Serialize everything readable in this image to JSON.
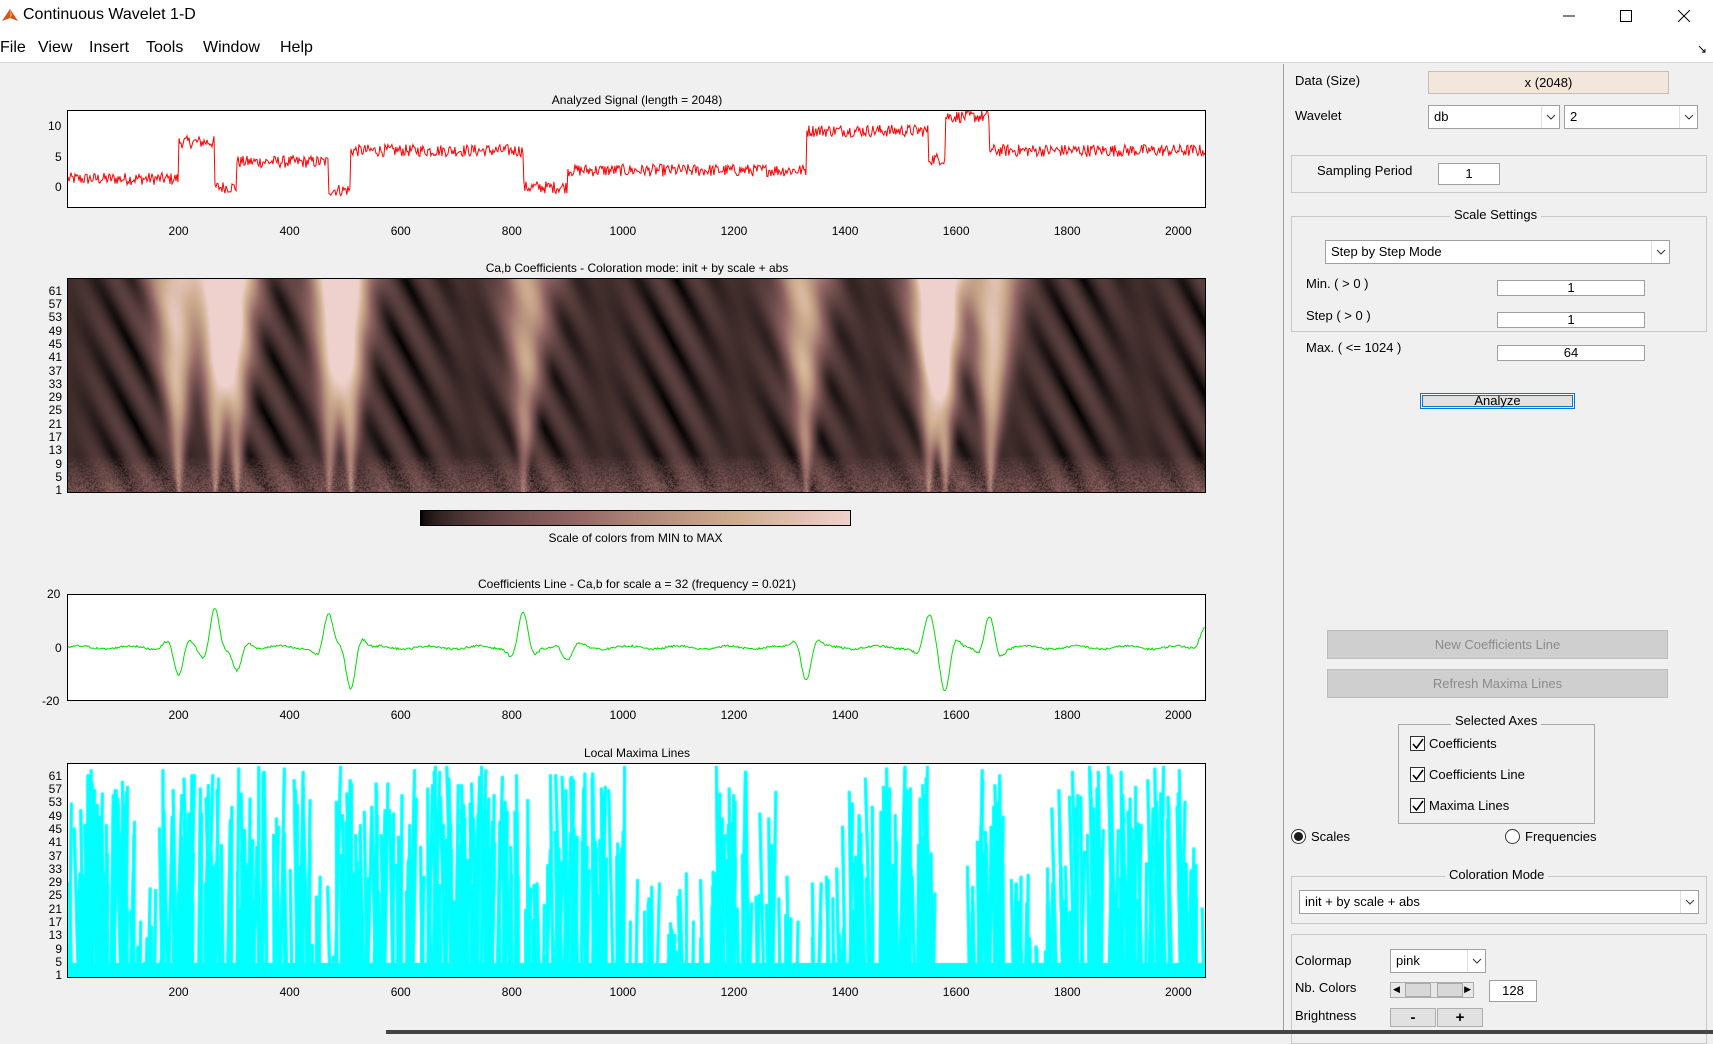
{
  "window": {
    "title": "Continuous Wavelet 1-D"
  },
  "menu": {
    "items": [
      "File",
      "View",
      "Insert",
      "Tools",
      "Window",
      "Help"
    ]
  },
  "colors": {
    "signal": "#ff0000",
    "coef_line": "#00dd00",
    "maxima": "#00ffff",
    "colormap": "pink"
  },
  "plots": {
    "x_ticks": [
      "200",
      "400",
      "600",
      "800",
      "1000",
      "1200",
      "1400",
      "1600",
      "1800",
      "2000"
    ],
    "signal": {
      "title": "Analyzed Signal (length = 2048)",
      "y_ticks": [
        "10",
        "5",
        "0"
      ]
    },
    "coefs": {
      "title": "Ca,b Coefficients - Coloration mode: init + by scale + abs",
      "y_ticks": [
        "61",
        "57",
        "53",
        "49",
        "45",
        "41",
        "37",
        "33",
        "29",
        "25",
        "21",
        "17",
        "13",
        "9",
        "5",
        "1"
      ],
      "colorbar_label": "Scale of colors from MIN to MAX"
    },
    "coef_line": {
      "title": "Coefficients Line - Ca,b for scale a = 32  (frequency =   0.021)",
      "y_ticks": [
        "20",
        "0",
        "-20"
      ]
    },
    "maxima": {
      "title": "Local Maxima Lines",
      "y_ticks": [
        "61",
        "57",
        "53",
        "49",
        "45",
        "41",
        "37",
        "33",
        "29",
        "25",
        "21",
        "17",
        "13",
        "9",
        "5",
        "1"
      ]
    }
  },
  "chart_data": [
    {
      "type": "line",
      "title": "Analyzed Signal (length = 2048)",
      "xlim": [
        1,
        2048
      ],
      "ylim": [
        -5,
        12
      ],
      "segments": [
        {
          "x": [
            1,
            200
          ],
          "level": 0
        },
        {
          "x": [
            200,
            265
          ],
          "level": 6.5
        },
        {
          "x": [
            265,
            305
          ],
          "level": -1.5
        },
        {
          "x": [
            305,
            470
          ],
          "level": 3
        },
        {
          "x": [
            470,
            510
          ],
          "level": -2
        },
        {
          "x": [
            510,
            820
          ],
          "level": 5
        },
        {
          "x": [
            820,
            900
          ],
          "level": -1.5
        },
        {
          "x": [
            900,
            1330
          ],
          "level": 1.5
        },
        {
          "x": [
            1330,
            1550
          ],
          "level": 8.5
        },
        {
          "x": [
            1550,
            1580
          ],
          "level": 3.5
        },
        {
          "x": [
            1580,
            1660
          ],
          "level": 11
        },
        {
          "x": [
            1660,
            2048
          ],
          "level": 5
        }
      ],
      "noise_amplitude": 1
    },
    {
      "type": "heatmap",
      "title": "Ca,b Coefficients - Coloration mode: init + by scale + abs",
      "xlim": [
        1,
        2048
      ],
      "ylim": [
        1,
        64
      ],
      "bright_cone_centers": [
        200,
        265,
        305,
        470,
        510,
        820,
        1330,
        1550,
        1580,
        1660
      ]
    },
    {
      "type": "line",
      "title": "Coefficients Line - Ca,b for scale a = 32  (frequency =   0.021)",
      "xlim": [
        1,
        2048
      ],
      "ylim": [
        -20,
        20
      ],
      "events": [
        {
          "x": 200,
          "amplitude": -11
        },
        {
          "x": 265,
          "amplitude": 15
        },
        {
          "x": 305,
          "amplitude": -9
        },
        {
          "x": 470,
          "amplitude": 12
        },
        {
          "x": 510,
          "amplitude": -15
        },
        {
          "x": 820,
          "amplitude": 13
        },
        {
          "x": 900,
          "amplitude": -5
        },
        {
          "x": 1330,
          "amplitude": -12
        },
        {
          "x": 1550,
          "amplitude": 10
        },
        {
          "x": 1580,
          "amplitude": -15
        },
        {
          "x": 1660,
          "amplitude": 12
        }
      ]
    },
    {
      "type": "scatter",
      "title": "Local Maxima Lines",
      "xlim": [
        1,
        2048
      ],
      "ylim": [
        1,
        64
      ]
    }
  ],
  "panel": {
    "data_label": "Data  (Size)",
    "data_value": "x  (2048)",
    "wavelet_label": "Wavelet",
    "wavelet_family": "db",
    "wavelet_order": "2",
    "sampling_label": "Sampling Period",
    "sampling_value": "1",
    "scale_settings": {
      "title": "Scale Settings",
      "mode": "Step by Step Mode",
      "min_label": "Min.  ( > 0 )",
      "min_value": "1",
      "step_label": "Step  ( > 0 )",
      "step_value": "1",
      "max_label": "Max.  ( <= 1024 )",
      "max_value": "64"
    },
    "analyze": "Analyze",
    "new_coef_line": "New Coefficients Line",
    "refresh_maxima": "Refresh Maxima Lines",
    "selected_axes": {
      "title": "Selected Axes",
      "items": [
        "Coefficients",
        "Coefficients Line",
        "Maxima Lines"
      ],
      "checked": [
        true,
        true,
        true
      ]
    },
    "scales_label": "Scales",
    "frequencies_label": "Frequencies",
    "coloration": {
      "title": "Coloration Mode",
      "value": "init + by scale + abs"
    },
    "colormap_label": "Colormap",
    "colormap_value": "pink",
    "nb_colors_label": "Nb. Colors",
    "nb_colors_value": "128",
    "brightness_label": "Brightness",
    "minus": "-",
    "plus": "+"
  }
}
